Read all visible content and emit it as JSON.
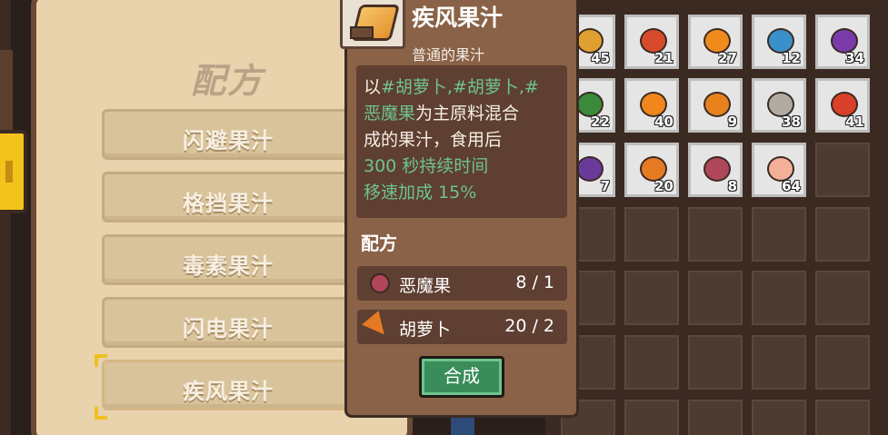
{
  "recipe_panel": {
    "title": "配方",
    "recipes": [
      {
        "label": "闪避果汁"
      },
      {
        "label": "格挡果汁"
      },
      {
        "label": "毒素果汁"
      },
      {
        "label": "闪电果汁"
      },
      {
        "label": "疾风果汁",
        "selected": true
      }
    ]
  },
  "tooltip": {
    "name": "疾风果汁",
    "subtitle": "普通的果汁",
    "description_line1_prefix": "以",
    "description_line1_tags": "#胡萝卜,#胡萝卜,#",
    "description_line2_tag": "恶魔果",
    "description_line2_rest": "为主原料混合",
    "description_line3": "成的果汁，食用后",
    "effect_duration": "300 秒持续时间",
    "effect_speed": "移速加成 15%",
    "recipe_label": "配方",
    "ingredients": [
      {
        "name": "恶魔果",
        "qty": "8 / 1",
        "icon": "demon-fruit-icon"
      },
      {
        "name": "胡萝卜",
        "qty": "20 / 2",
        "icon": "carrot-icon"
      }
    ],
    "craft_label": "合成"
  },
  "inventory": {
    "items": [
      {
        "count": "45",
        "icon": "wheat-icon",
        "color": "#e0a030"
      },
      {
        "count": "21",
        "icon": "tomato-icon",
        "color": "#d84a2c"
      },
      {
        "count": "27",
        "icon": "orange-berry-icon",
        "color": "#f08a1c"
      },
      {
        "count": "12",
        "icon": "blue-berry-icon",
        "color": "#3a90c8"
      },
      {
        "count": "34",
        "icon": "eggplant-icon",
        "color": "#7a3aa8"
      },
      {
        "count": "22",
        "icon": "vine-icon",
        "color": "#3a8a3a"
      },
      {
        "count": "40",
        "icon": "orange-icon",
        "color": "#f0861c"
      },
      {
        "count": "9",
        "icon": "pumpkin-icon",
        "color": "#e8801c"
      },
      {
        "count": "38",
        "icon": "coconut-icon",
        "color": "#b0aca4"
      },
      {
        "count": "41",
        "icon": "fire-fruit-icon",
        "color": "#d8402a"
      },
      {
        "count": "7",
        "icon": "grape-icon",
        "color": "#6a3a9a"
      },
      {
        "count": "20",
        "icon": "carrot-icon",
        "color": "#e67a23"
      },
      {
        "count": "8",
        "icon": "demon-fruit-icon",
        "color": "#b0465a"
      },
      {
        "count": "64",
        "icon": "peach-icon",
        "color": "#f5b09a"
      }
    ]
  }
}
